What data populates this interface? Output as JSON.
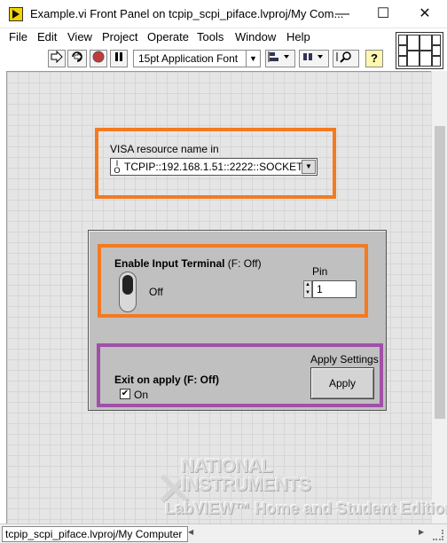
{
  "window": {
    "title": "Example.vi Front Panel on tcpip_scpi_piface.lvproj/My Com...",
    "minimize": "—",
    "maximize": "☐",
    "close": "✕"
  },
  "menu": [
    "File",
    "Edit",
    "View",
    "Project",
    "Operate",
    "Tools",
    "Window",
    "Help"
  ],
  "toolbar": {
    "run_icon": "run-arrow-icon",
    "font": "15pt Application Font"
  },
  "visa": {
    "label": "VISA resource name in",
    "io_glyph": "I/O",
    "value": "TCPIP::192.168.1.51::2222::SOCKET"
  },
  "panel": {
    "enable_label_bold": "Enable Input Terminal",
    "enable_label_rest": " (F: Off)",
    "toggle_state": "Off",
    "pin_label": "Pin",
    "pin_value": "1",
    "apply_settings_label": "Apply Settings",
    "apply_button": "Apply",
    "exit_label": "Exit on apply (F: Off)",
    "exit_checkbox_label": "On",
    "exit_checked": true
  },
  "watermark": {
    "line1": "NATIONAL",
    "line2": "INSTRUMENTS",
    "line3": "LabVIEW™ Home and Student Edition"
  },
  "status": {
    "context": "tcpip_scpi_piface.lvproj/My Computer"
  },
  "colors": {
    "orange_highlight": "#f47a20",
    "purple_highlight": "#a050a8",
    "panel_bg": "#c0c0c0"
  }
}
